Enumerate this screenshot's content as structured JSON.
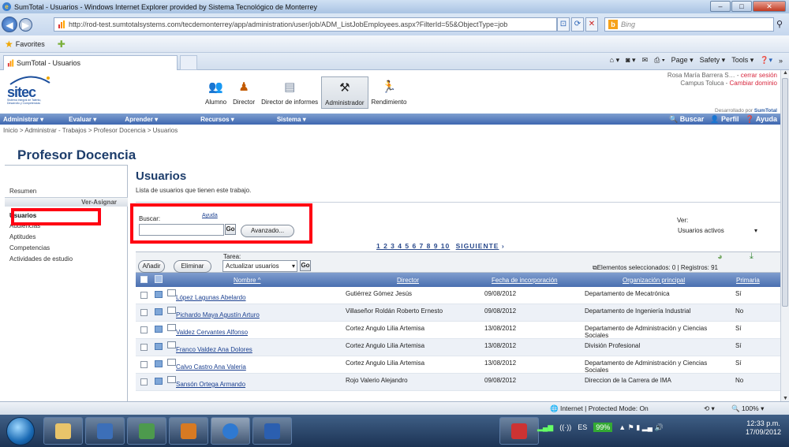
{
  "window": {
    "title": "SumTotal - Usuarios - Windows Internet Explorer provided by Sistema Tecnológico de Monterrey"
  },
  "address": {
    "url": "http://rod-test.sumtotalsystems.com/tecdemonterrey/app/administration/user/job/ADM_ListJobEmployees.aspx?FilterId=55&ObjectType=job",
    "search_placeholder": "Bing"
  },
  "favorites": {
    "label": "Favorites"
  },
  "tab": {
    "label": "SumTotal - Usuarios"
  },
  "commandbar": {
    "page": "Page ▾",
    "safety": "Safety ▾",
    "tools": "Tools ▾"
  },
  "header": {
    "logo": "sitec",
    "logo_sub": "Sistema Integral de Talento, Desarrollo y Competencias",
    "roles": [
      {
        "label": "Alumno",
        "icon": "student-icon"
      },
      {
        "label": "Director",
        "icon": "director-icon"
      },
      {
        "label": "Director de informes",
        "icon": "report-icon"
      },
      {
        "label": "Administrador",
        "icon": "admin-tools-icon"
      },
      {
        "label": "Rendimiento",
        "icon": "performance-icon"
      }
    ],
    "user_line": "Rosa María Barrera S… - ",
    "logout": "cerrar sesión",
    "campus_line": "Campus Toluca - ",
    "change_domain": "Cambiar dominio",
    "devby_prefix": "Desarrollado por ",
    "devby_brand": "SumTotal"
  },
  "menu": {
    "items": [
      "Administrar ▾",
      "Evaluar ▾",
      "Aprender ▾",
      "Recursos ▾",
      "Sistema ▾"
    ],
    "search": "Buscar",
    "profile": "Perfil",
    "help": "Ayuda"
  },
  "breadcrumb": "Inicio > Administrar - Trabajos > Profesor Docencia > Usuarios",
  "page_title": "Profesor Docencia",
  "sidebar": {
    "resumen": "Resumen",
    "section": "Ver-Asignar",
    "items": [
      "Usuarios",
      "Audiencias",
      "Aptitudes",
      "Competencias",
      "Actividades de estudio"
    ]
  },
  "main": {
    "title": "Usuarios",
    "subtitle": "Lista de usuarios que tienen este trabajo.",
    "search_label": "Buscar:",
    "help_link": "Ayuda",
    "go": "Go",
    "advanced": "Avanzado...",
    "view_label": "Ver:",
    "view_value": "Usuarios activos",
    "pager": "1 2 3 4 5 6 7 8 9 10",
    "next": "SIGUIENTE",
    "task_label": "Tarea:",
    "add": "Añadir",
    "delete": "Eliminar",
    "task_value": "Actualizar usuarios",
    "selected_info": "Elementos seleccionados: 0 | Registros: 91",
    "columns": [
      "Nombre ^",
      "Director",
      "Fecha de incorporación",
      "Organización principal",
      "Primaria"
    ],
    "rows": [
      {
        "name": "López Lagunas Abelardo",
        "director": "Gutiérrez Gómez Jesús",
        "date": "09/08/2012",
        "org": "Departamento de Mecatrónica",
        "primary": "Sí"
      },
      {
        "name": "Pichardo Maya Agustín Arturo",
        "director": "Villaseñor Roldán Roberto Ernesto",
        "date": "09/08/2012",
        "org": "Departamento de Ingeniería Industrial",
        "primary": "No"
      },
      {
        "name": "Valdez Cervantes Alfonso",
        "director": "Cortez Angulo Lilia Artemisa",
        "date": "13/08/2012",
        "org": "Departamento de Administración y Ciencias Sociales",
        "primary": "Sí"
      },
      {
        "name": "Franco Valdez Ana Dolores",
        "director": "Cortez Angulo Lilia Artemisa",
        "date": "13/08/2012",
        "org": "División Profesional",
        "primary": "Sí"
      },
      {
        "name": "Calvo Castro Ana Valeria",
        "director": "Cortez Angulo Lilia Artemisa",
        "date": "13/08/2012",
        "org": "Departamento de Administración y Ciencias Sociales",
        "primary": "Sí"
      },
      {
        "name": "Sansón Ortega Armando",
        "director": "Rojo Valerio Alejandro",
        "date": "09/08/2012",
        "org": "Direccion de la Carrera de IMA",
        "primary": "No"
      }
    ]
  },
  "status": {
    "zone": "Internet | Protected Mode: On",
    "zoom": "100%"
  },
  "tray": {
    "lang": "ES",
    "battery": "99%",
    "time": "12:33 p.m.",
    "date": "17/09/2012"
  },
  "colors": {
    "menu": "#4a6fb0",
    "highlight": "#ff0012",
    "title": "#1d3d6b"
  }
}
